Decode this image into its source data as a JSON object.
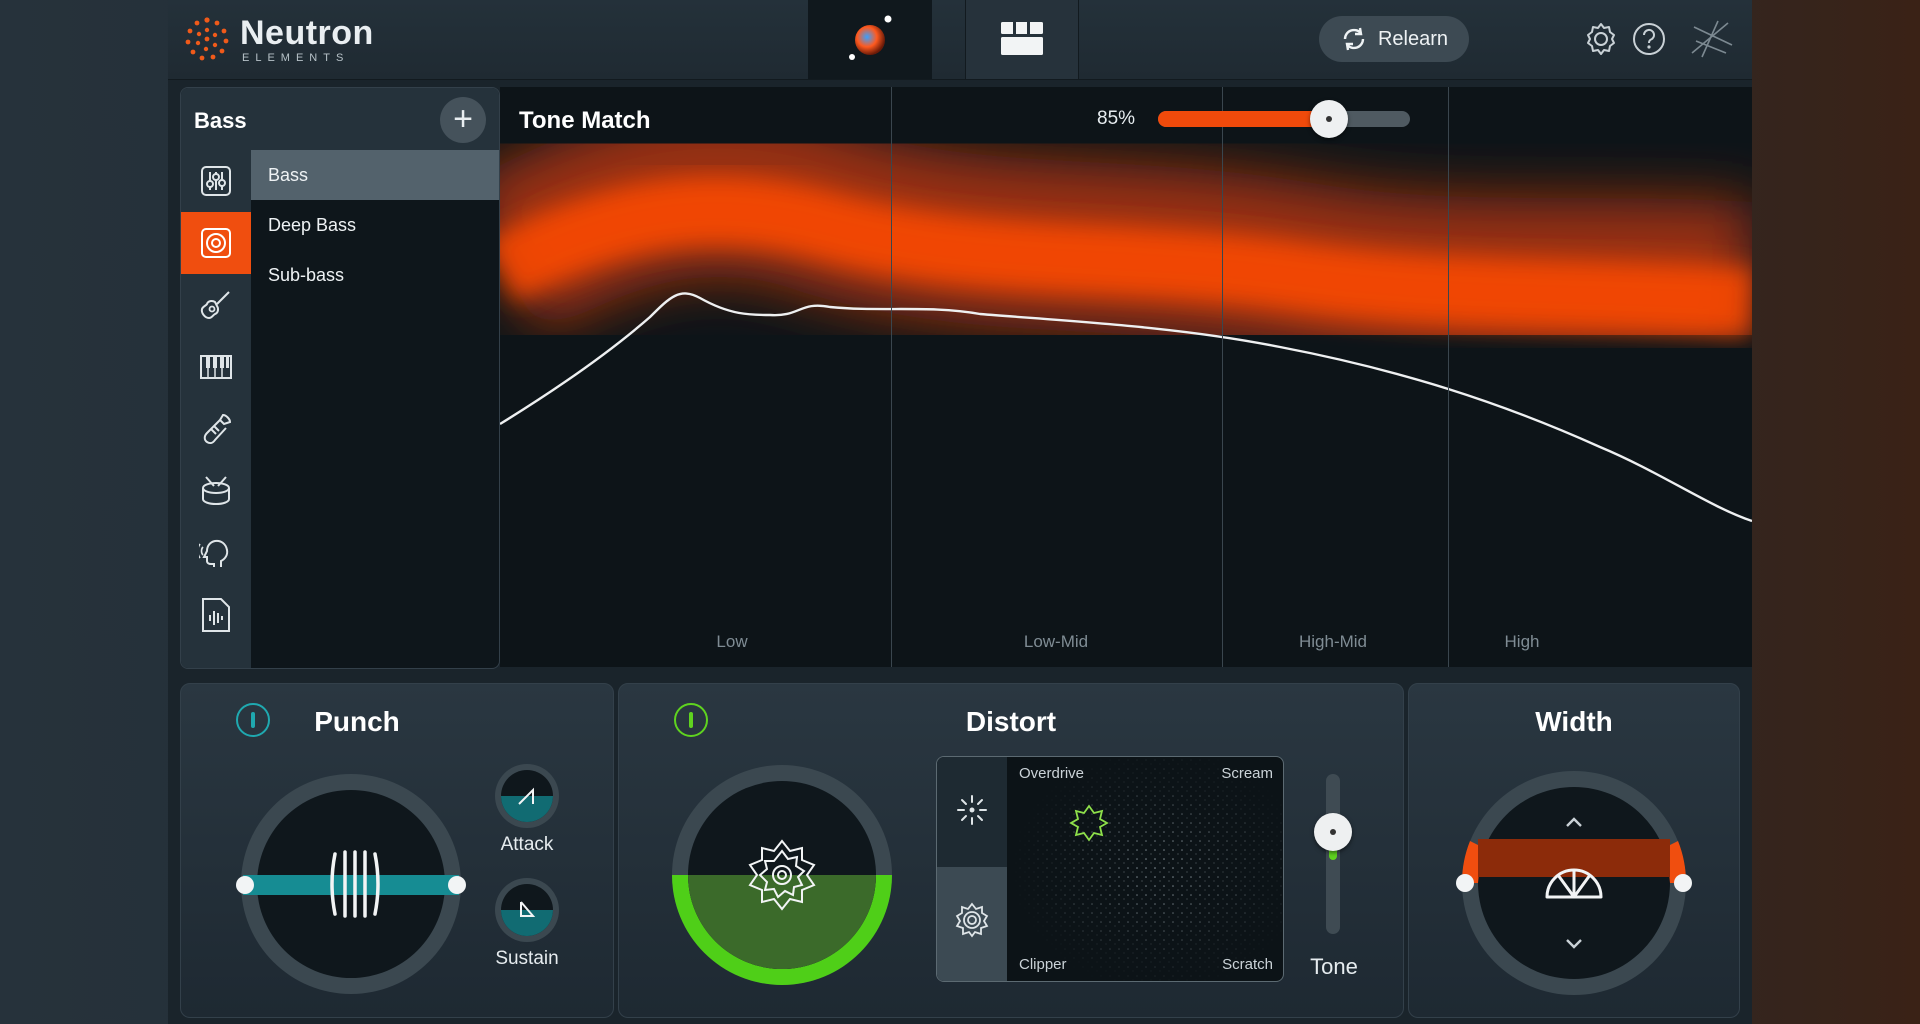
{
  "header": {
    "brand_name": "Neutron",
    "brand_sub": "ELEMENTS",
    "relearn_label": "Relearn",
    "icons": [
      "assistant-icon",
      "mixer-icon",
      "refresh-icon",
      "gear-icon",
      "help-icon",
      "izotope-logo-icon"
    ]
  },
  "sidebar": {
    "title": "Bass",
    "add_label": "+",
    "icons": [
      "sliders-icon",
      "speaker-icon",
      "guitar-icon",
      "piano-icon",
      "brass-icon",
      "drum-icon",
      "voice-icon",
      "audio-file-icon"
    ],
    "items": [
      {
        "label": "Bass",
        "selected": true
      },
      {
        "label": "Deep Bass",
        "selected": false
      },
      {
        "label": "Sub-bass",
        "selected": false
      }
    ]
  },
  "tone_match": {
    "title": "Tone Match",
    "amount_label": "85%",
    "amount": 0.85,
    "bands": [
      "Low",
      "Low-Mid",
      "High-Mid",
      "High"
    ]
  },
  "punch": {
    "title": "Punch",
    "attack_label": "Attack",
    "sustain_label": "Sustain",
    "accent": "#1fa9b0"
  },
  "distort": {
    "title": "Distort",
    "corner_labels": {
      "top_left": "Overdrive",
      "top_right": "Scream",
      "bottom_left": "Clipper",
      "bottom_right": "Scratch"
    },
    "tone_label": "Tone",
    "accent": "#5fd31f"
  },
  "width": {
    "title": "Width",
    "accent": "#f04e0f"
  },
  "colors": {
    "accent_orange": "#f04e0f",
    "accent_teal": "#1fa9b0",
    "accent_green": "#5fd31f"
  }
}
